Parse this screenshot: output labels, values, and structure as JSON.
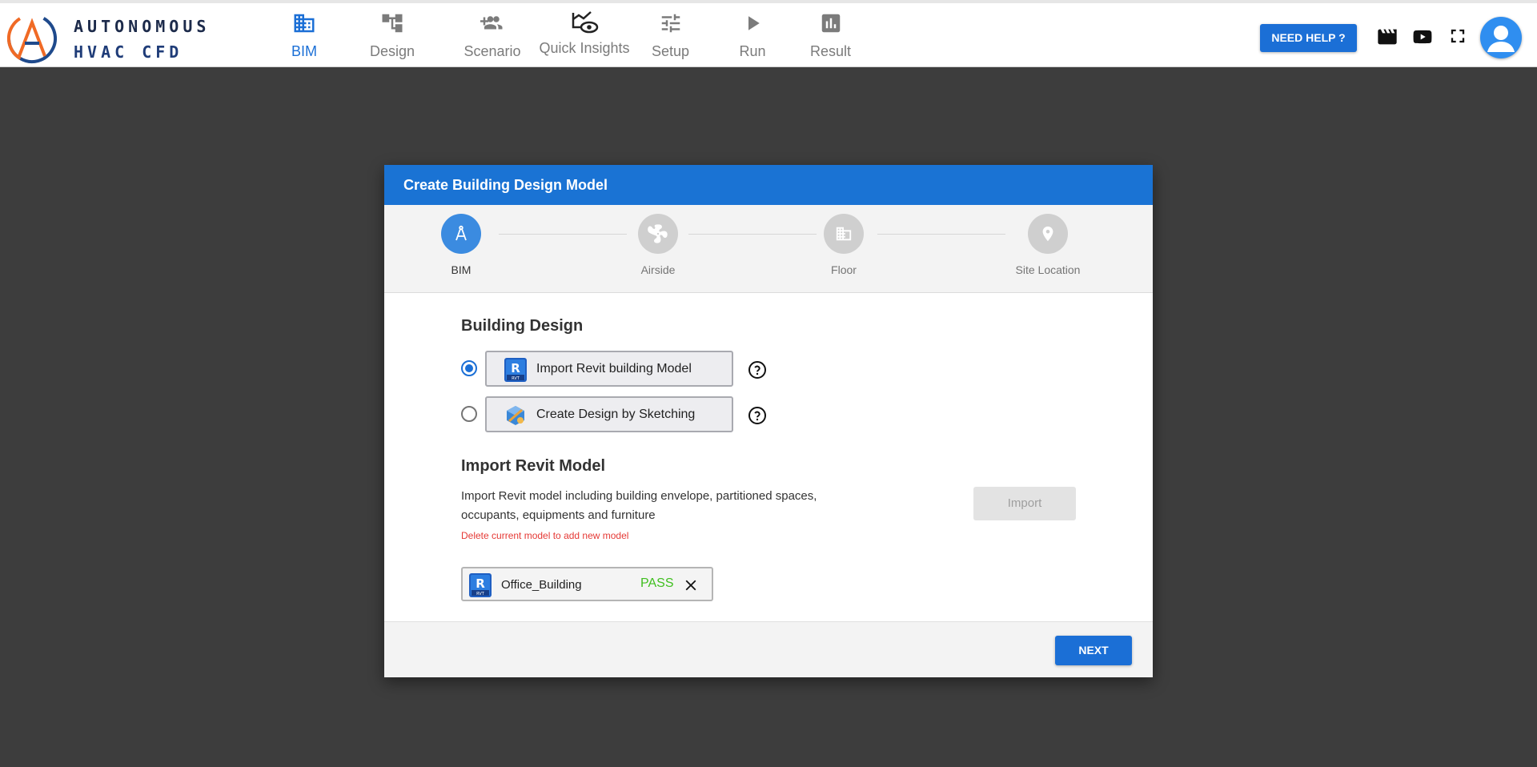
{
  "app": {
    "logo_line1": "AUTONOMOUS",
    "logo_line2": "HVAC CFD"
  },
  "nav": {
    "items": [
      {
        "label": "BIM",
        "icon": "building-icon",
        "active": true
      },
      {
        "label": "Design",
        "icon": "hierarchy-icon",
        "active": false
      },
      {
        "label": "Scenario",
        "icon": "add-people-icon",
        "active": false
      },
      {
        "label": "Quick Insights",
        "icon": "insight-eye-icon",
        "active": false
      },
      {
        "label": "Setup",
        "icon": "sliders-icon",
        "active": false
      },
      {
        "label": "Run",
        "icon": "play-icon",
        "active": false
      },
      {
        "label": "Result",
        "icon": "bar-chart-icon",
        "active": false
      }
    ]
  },
  "toolbar": {
    "help_label": "NEED HELP ?",
    "icons": [
      "clapperboard-icon",
      "youtube-icon",
      "fullscreen-icon",
      "user-avatar-icon"
    ]
  },
  "dialog": {
    "title": "Create Building Design Model",
    "steps": [
      {
        "label": "BIM",
        "icon": "compass-icon",
        "active": true
      },
      {
        "label": "Airside",
        "icon": "fan-icon",
        "active": false
      },
      {
        "label": "Floor",
        "icon": "building-icon",
        "active": false
      },
      {
        "label": "Site Location",
        "icon": "location-pin-icon",
        "active": false
      }
    ],
    "building_design": {
      "title": "Building Design",
      "options": [
        {
          "label": "Import Revit building Model",
          "selected": true,
          "icon": "revit-icon"
        },
        {
          "label": "Create Design by Sketching",
          "selected": false,
          "icon": "sketch-icon"
        }
      ]
    },
    "import_revit": {
      "title": "Import Revit Model",
      "description": "Import Revit model including building envelope, partitioned spaces, occupants, equipments and furniture",
      "warning": "Delete current model to add new model",
      "import_label": "Import"
    },
    "file": {
      "name": "Office_Building",
      "status": "PASS",
      "icon_letter": "R",
      "icon_sub": "RVT"
    },
    "next_label": "NEXT"
  },
  "colors": {
    "accent": "#1b6fd6",
    "header": "#1a73d4",
    "pass": "#3fbf1f",
    "warning": "#e53935",
    "backdrop": "#3d3d3d"
  }
}
